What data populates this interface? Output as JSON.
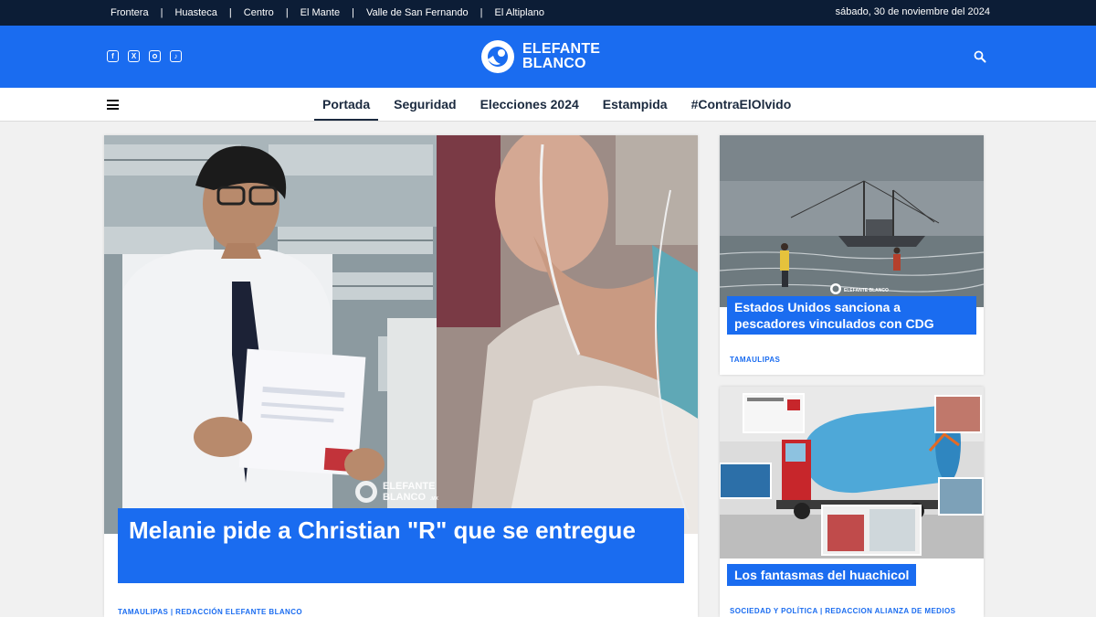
{
  "topbar": {
    "regions": [
      "Frontera",
      "Huasteca",
      "Centro",
      "El Mante",
      "Valle de San Fernando",
      "El Altiplano"
    ],
    "separator": "|",
    "date": "sábado, 30 de noviembre del 2024"
  },
  "header": {
    "logo": {
      "line1": "ELEFANTE",
      "line2": "BLANCO"
    },
    "social_icons": [
      "facebook-icon",
      "x-icon",
      "instagram-icon",
      "tiktok-icon"
    ],
    "brand_color": "#1a6cf0",
    "topbar_color": "#0c1d36"
  },
  "nav": {
    "links": [
      "Portada",
      "Seguridad",
      "Elecciones 2024",
      "Estampida",
      "#ContraElOlvido"
    ],
    "active": "Portada"
  },
  "feature": {
    "headline": "Melanie pide a Christian \"R\" que se entregue",
    "meta": "TAMAULIPAS | REDACCIÓN ELEFANTE BLANCO",
    "watermark": {
      "line1": "ELEFANTE",
      "line2": "BLANCO",
      "suffix": ".MX"
    }
  },
  "side_cards": [
    {
      "headline": "Estados Unidos sanciona a pescadores vinculados con CDG",
      "meta": "TAMAULIPAS",
      "watermark": "ELEFANTE BLANCO"
    },
    {
      "headline": "Los fantasmas del huachicol",
      "meta": "SOCIEDAD Y POLÍTICA | REDACCION ALIANZA DE MEDIOS"
    }
  ]
}
